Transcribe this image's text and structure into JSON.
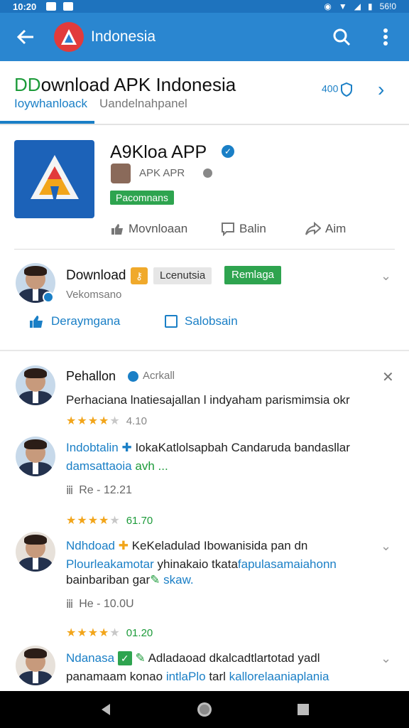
{
  "status_bar": {
    "time": "10:20",
    "right_label": "56!0"
  },
  "app_bar": {
    "title": "Indonesia"
  },
  "tab_header": {
    "title_accent": "DD",
    "title_rest": "ownload APK Indonesia",
    "tab_active": "Ioywhanloack",
    "tab_inactive": "Uandelnahpanel",
    "side_link": "400"
  },
  "app_info": {
    "name": "A9Kloa APP",
    "developer": "APK APR",
    "badge": "Pacomnans",
    "actions": [
      "Movnloaan",
      "Balin",
      "Aim"
    ]
  },
  "download_row": {
    "title": "Download",
    "chip_grey": "Lcenutsia",
    "chip_green": "Remlaga",
    "version": "Vekomsano",
    "link1": "Deraymgana",
    "link2": "Salobsain"
  },
  "reviews": [
    {
      "name": "Pehallon",
      "tag": "Acrkall",
      "text": "Perhaciana lnatiesajallan l indyaham parismimsia okr",
      "stars": 4,
      "rating": "4.10"
    },
    {
      "name": "Indobtalin",
      "tag": "IokaKatlolsapbah Candaruda bandasllar",
      "text_blue": "damsattaoia",
      "text_green": "avh",
      "text_tail": " ...",
      "meta_icon": "ⅲ",
      "meta": "Re - 12.21",
      "stars": 4,
      "rating": "61.70"
    },
    {
      "name": "Ndhdoad",
      "tag": "KeKeladulad Ibowanisida pan dn",
      "line2_blue1": "Plourleakamotar",
      "line2_dark": " yhinakaio tkata",
      "line2_blue2": "fapulasamaiahonn",
      "line3": "bainbariban gar",
      "line3_blue": " skaw.",
      "meta": "He - 10.0U",
      "stars": 4,
      "rating": "01.20"
    },
    {
      "name": "Ndanasa",
      "tag": "Adladaoad dkalcadtlartotad yadl",
      "line2_dark": "panamaam konao ",
      "line2_blue1": "intlaPlo",
      "line2_mid": " tarl ",
      "line2_blue2": "kallorelaaniaplania"
    }
  ],
  "colors": {
    "app_bar": "#2a86d0",
    "accent_blue": "#1a7fc6",
    "accent_green": "#2ea44f",
    "star": "#f2a51a"
  }
}
